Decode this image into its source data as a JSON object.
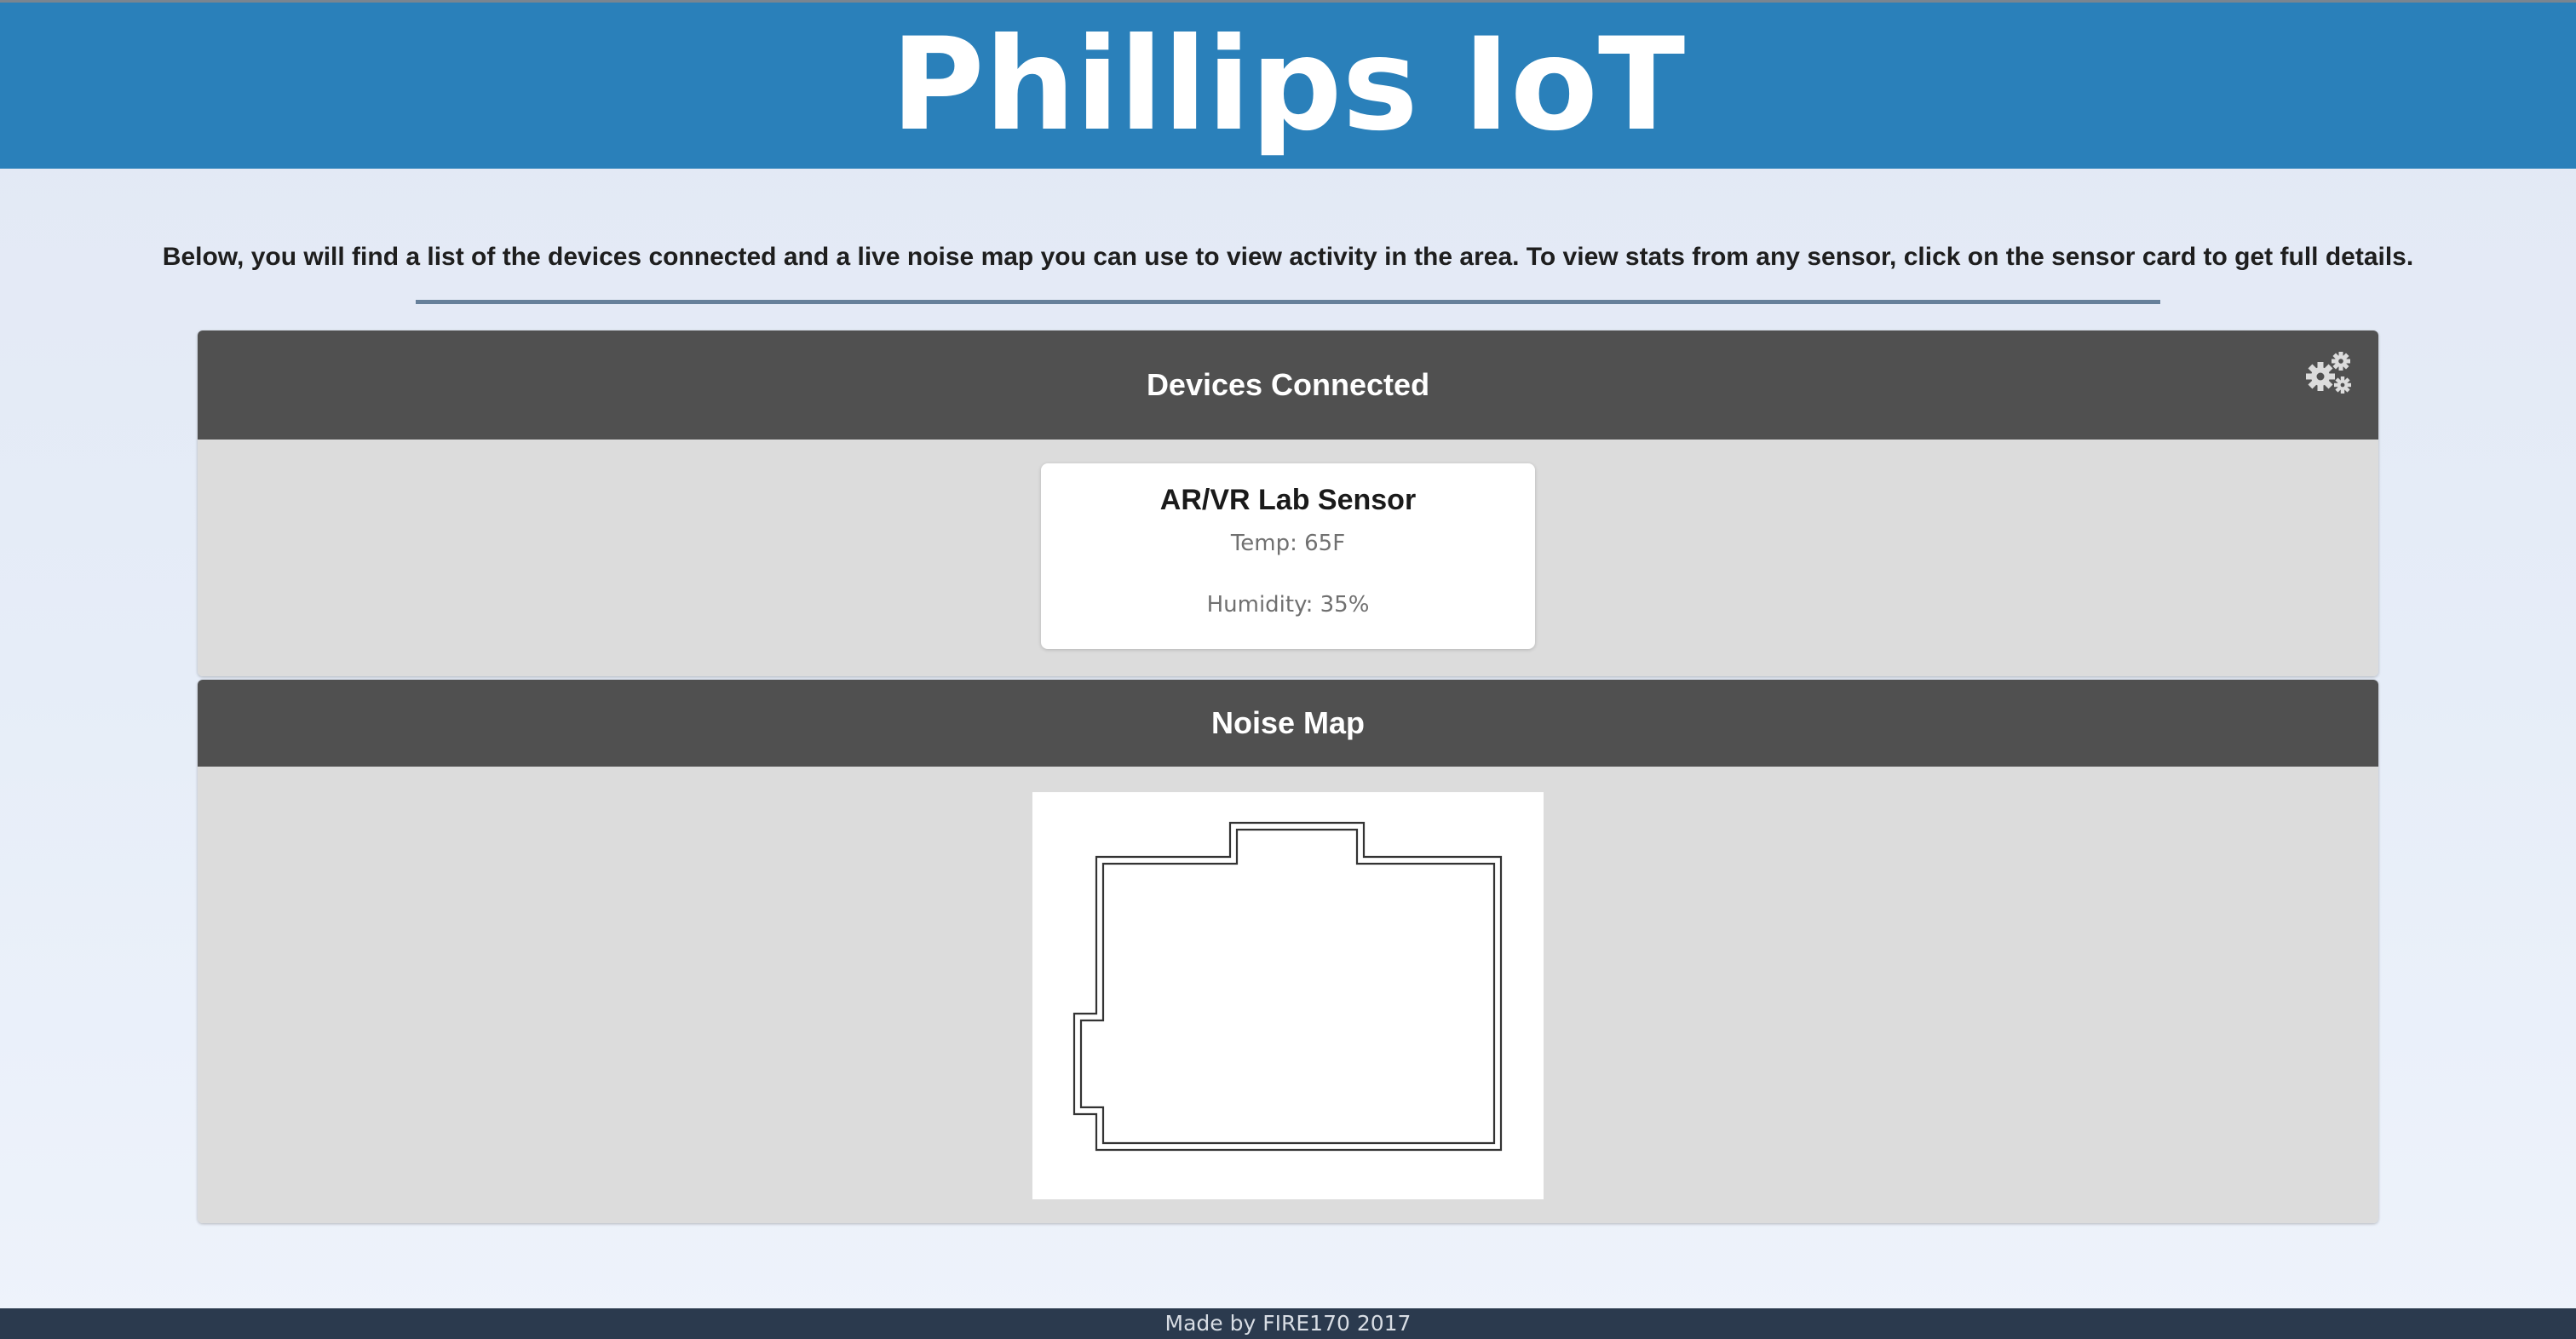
{
  "header": {
    "title": "Phillips IoT"
  },
  "intro": {
    "text": "Below, you will find a list of the devices connected and a live noise map you can use to view activity in the area. To view stats from any sensor, click on the sensor card to get full details."
  },
  "devices": {
    "title": "Devices Connected",
    "settings_icon": "gears-icon",
    "sensors": [
      {
        "name": "AR/VR Lab Sensor",
        "temp": "Temp: 65F",
        "humidity": "Humidity: 35%"
      }
    ]
  },
  "noise_map": {
    "title": "Noise Map",
    "map_icon": "floorplan-outline"
  },
  "footer": {
    "text": "Made by FIRE170 2017"
  },
  "colors": {
    "header_bg": "#2a80ba",
    "panel_head_bg": "#505050",
    "panel_body_bg": "#dcdcdc",
    "divider": "#66809a",
    "footer_bg": "#2b3a4e"
  }
}
